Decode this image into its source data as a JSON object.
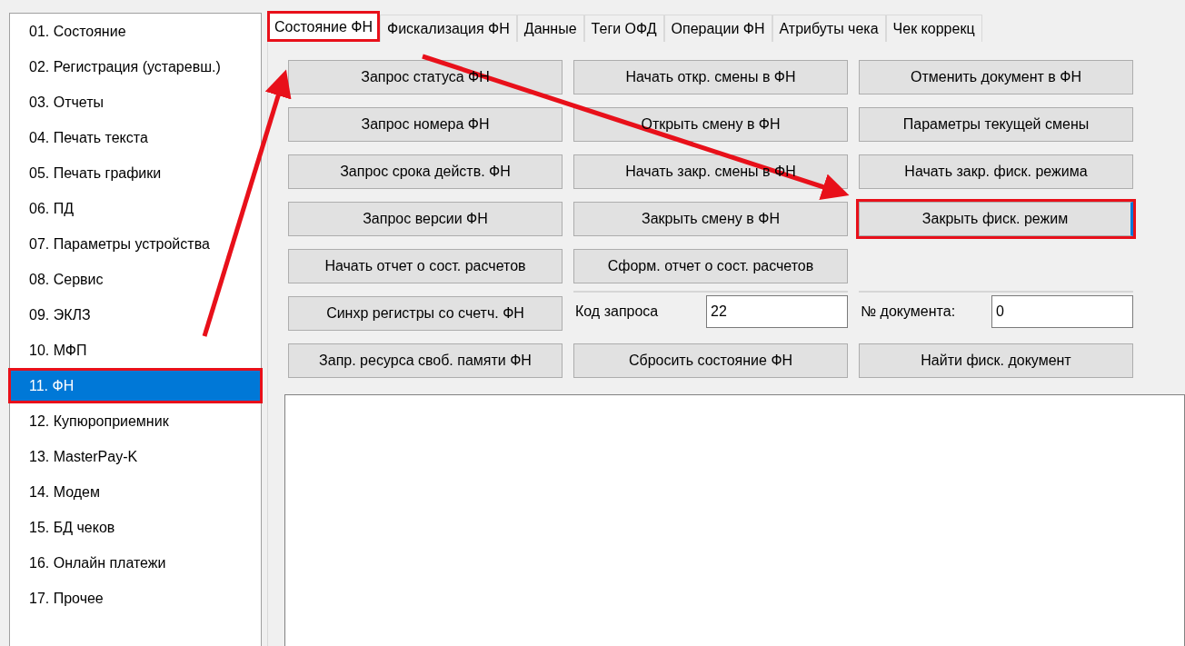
{
  "sidebar": {
    "items": [
      {
        "label": "01. Состояние",
        "selected": false,
        "highlighted": false
      },
      {
        "label": "02. Регистрация (устаревш.)",
        "selected": false,
        "highlighted": false
      },
      {
        "label": "03. Отчеты",
        "selected": false,
        "highlighted": false
      },
      {
        "label": "04. Печать текста",
        "selected": false,
        "highlighted": false
      },
      {
        "label": "05. Печать графики",
        "selected": false,
        "highlighted": false
      },
      {
        "label": "06. ПД",
        "selected": false,
        "highlighted": false
      },
      {
        "label": "07. Параметры устройства",
        "selected": false,
        "highlighted": false
      },
      {
        "label": "08. Сервис",
        "selected": false,
        "highlighted": false
      },
      {
        "label": "09. ЭКЛЗ",
        "selected": false,
        "highlighted": false
      },
      {
        "label": "10. МФП",
        "selected": false,
        "highlighted": false
      },
      {
        "label": "11. ФН",
        "selected": true,
        "highlighted": true
      },
      {
        "label": "12. Купюроприемник",
        "selected": false,
        "highlighted": false
      },
      {
        "label": "13. MasterPay-K",
        "selected": false,
        "highlighted": false
      },
      {
        "label": "14. Модем",
        "selected": false,
        "highlighted": false
      },
      {
        "label": "15. БД чеков",
        "selected": false,
        "highlighted": false
      },
      {
        "label": "16. Онлайн платежи",
        "selected": false,
        "highlighted": false
      },
      {
        "label": "17. Прочее",
        "selected": false,
        "highlighted": false
      }
    ]
  },
  "tabs": [
    {
      "label": "Состояние ФН",
      "selected": true,
      "highlighted": true
    },
    {
      "label": "Фискализация ФН",
      "selected": false,
      "highlighted": false
    },
    {
      "label": "Данные",
      "selected": false,
      "highlighted": false
    },
    {
      "label": "Теги ОФД",
      "selected": false,
      "highlighted": false
    },
    {
      "label": "Операции ФН",
      "selected": false,
      "highlighted": false
    },
    {
      "label": "Атрибуты чека",
      "selected": false,
      "highlighted": false
    },
    {
      "label": "Чек коррекц",
      "selected": false,
      "highlighted": false
    }
  ],
  "grid": [
    [
      {
        "kind": "button",
        "label": "Запрос статуса ФН",
        "highlighted": false,
        "focused": false
      },
      {
        "kind": "button",
        "label": "Начать откр. смены в ФН",
        "highlighted": false,
        "focused": false
      },
      {
        "kind": "button",
        "label": "Отменить документ в ФН",
        "highlighted": false,
        "focused": false
      }
    ],
    [
      {
        "kind": "button",
        "label": "Запрос номера ФН",
        "highlighted": false,
        "focused": false
      },
      {
        "kind": "button",
        "label": "Открыть смену в ФН",
        "highlighted": false,
        "focused": false
      },
      {
        "kind": "button",
        "label": "Параметры текущей смены",
        "highlighted": false,
        "focused": false
      }
    ],
    [
      {
        "kind": "button",
        "label": "Запрос срока действ. ФН",
        "highlighted": false,
        "focused": false
      },
      {
        "kind": "button",
        "label": "Начать закр. смены в ФН",
        "highlighted": false,
        "focused": false
      },
      {
        "kind": "button",
        "label": "Начать закр. фиск. режима",
        "highlighted": false,
        "focused": false
      }
    ],
    [
      {
        "kind": "button",
        "label": "Запрос версии ФН",
        "highlighted": false,
        "focused": false
      },
      {
        "kind": "button",
        "label": "Закрыть смену в ФН",
        "highlighted": false,
        "focused": false
      },
      {
        "kind": "button",
        "label": "Закрыть фиск. режим",
        "highlighted": true,
        "focused": true
      }
    ],
    [
      {
        "kind": "button",
        "label": "Начать отчет о сост. расчетов",
        "highlighted": false,
        "focused": false
      },
      {
        "kind": "button",
        "label": "Сформ. отчет о сост. расчетов",
        "highlighted": false,
        "focused": false
      },
      {
        "kind": "empty"
      }
    ],
    [
      {
        "kind": "button",
        "label": "Синхр регистры со счетч. ФН",
        "highlighted": false,
        "focused": false
      },
      {
        "kind": "field",
        "label": "Код запроса",
        "value": "22"
      },
      {
        "kind": "field",
        "label": "№ документа:",
        "value": "0"
      }
    ],
    [
      {
        "kind": "button",
        "label": "Запр. ресурса своб. памяти ФН",
        "highlighted": false,
        "focused": false
      },
      {
        "kind": "button",
        "label": "Сбросить состояние ФН",
        "highlighted": false,
        "focused": false
      },
      {
        "kind": "button",
        "label": "Найти фиск. документ",
        "highlighted": false,
        "focused": false
      }
    ]
  ]
}
